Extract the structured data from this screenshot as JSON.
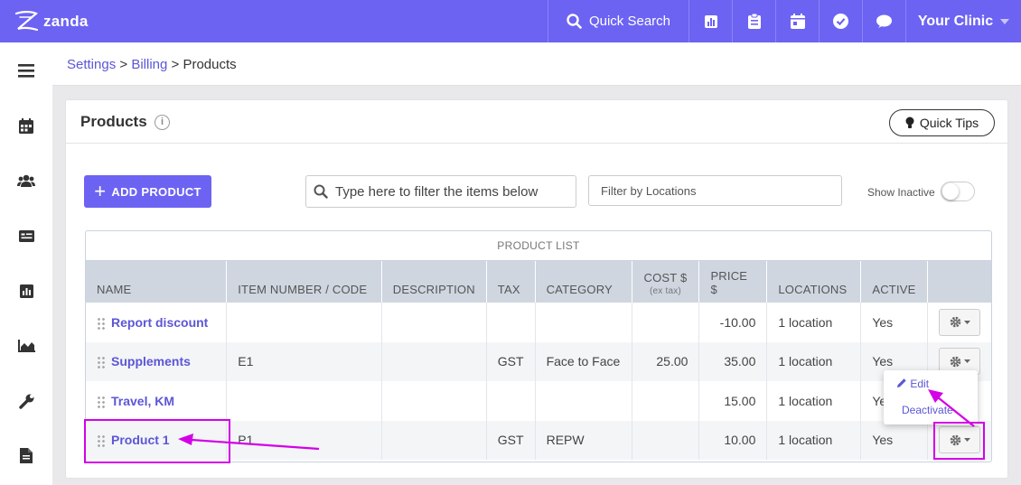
{
  "app": {
    "logo_text": "zanda"
  },
  "topbar": {
    "search_label": "Quick Search",
    "clinic_label": "Your Clinic",
    "icons": [
      "bar-chart-icon",
      "clipboard-icon",
      "calendar-icon",
      "check-circle-icon",
      "chat-icon"
    ]
  },
  "sidebar": {
    "icons": [
      "menu-icon",
      "calendar-icon",
      "users-icon",
      "id-card-icon",
      "report-icon",
      "area-chart-icon",
      "wrench-icon",
      "document-icon"
    ]
  },
  "breadcrumb": {
    "item1": "Settings",
    "sep": ">",
    "item2": "Billing",
    "current": "Products"
  },
  "page": {
    "title": "Products",
    "quick_tips": "Quick Tips"
  },
  "toolbar": {
    "add_label": "ADD PRODUCT",
    "filter_placeholder": "Type here to filter the items below",
    "locations_placeholder": "Filter by Locations",
    "show_inactive": "Show Inactive"
  },
  "table": {
    "title": "PRODUCT LIST",
    "headers": {
      "name": "NAME",
      "code": "ITEM NUMBER / CODE",
      "desc": "DESCRIPTION",
      "tax": "TAX",
      "category": "CATEGORY",
      "cost": "COST $",
      "cost_sub": "(ex tax)",
      "price": "PRICE $",
      "locations": "LOCATIONS",
      "active": "ACTIVE"
    },
    "rows": [
      {
        "name": "Report discount",
        "code": "",
        "desc": "",
        "tax": "",
        "category": "",
        "cost": "",
        "price": "-10.00",
        "locations": "1 location",
        "active": "Yes"
      },
      {
        "name": "Supplements",
        "code": "E1",
        "desc": "",
        "tax": "GST",
        "category": "Face to Face",
        "cost": "25.00",
        "price": "35.00",
        "locations": "1 location",
        "active": "Yes"
      },
      {
        "name": "Travel, KM",
        "code": "",
        "desc": "",
        "tax": "",
        "category": "",
        "cost": "",
        "price": "15.00",
        "locations": "1 location",
        "active": "Yes"
      },
      {
        "name": "Product 1",
        "code": "P1",
        "desc": "",
        "tax": "GST",
        "category": "REPW",
        "cost": "",
        "price": "10.00",
        "locations": "1 location",
        "active": "Yes"
      }
    ]
  },
  "dropdown": {
    "edit": "Edit",
    "deactivate": "Deactivate"
  },
  "colors": {
    "brand": "#6c63f3",
    "link": "#5c56d6",
    "highlight": "#d400e8"
  }
}
